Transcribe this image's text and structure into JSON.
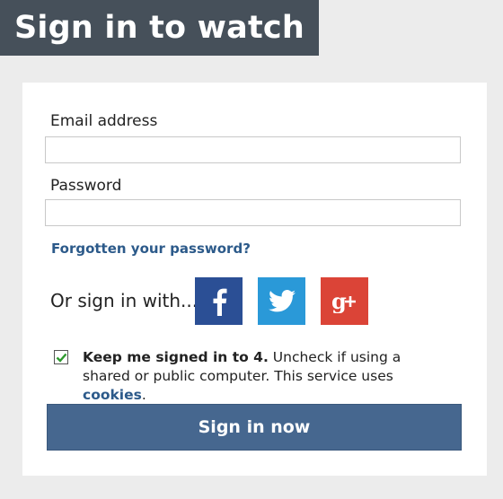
{
  "header": {
    "title": "Sign in to watch"
  },
  "form": {
    "email_label": "Email address",
    "email_value": "",
    "email_placeholder": "",
    "password_label": "Password",
    "password_value": "",
    "password_placeholder": "",
    "forgot_link": "Forgotten your password?",
    "social_prompt": "Or sign in with...",
    "social_buttons": [
      {
        "name": "facebook",
        "icon": "facebook-icon",
        "color": "#2b4f95"
      },
      {
        "name": "twitter",
        "icon": "twitter-icon",
        "color": "#2a99d8"
      },
      {
        "name": "google-plus",
        "icon": "google-plus-icon",
        "color": "#db4437"
      }
    ],
    "keep_signed_in": {
      "checked": true,
      "bold_text": "Keep me signed in to 4.",
      "text": " Uncheck if using a shared or public computer. This service uses ",
      "link": "cookies",
      "suffix": "."
    },
    "submit_label": "Sign in now"
  },
  "colors": {
    "header_bg": "#46505a",
    "link": "#2c5a8a",
    "submit_bg": "#46678f",
    "check": "#2e9a2e"
  }
}
